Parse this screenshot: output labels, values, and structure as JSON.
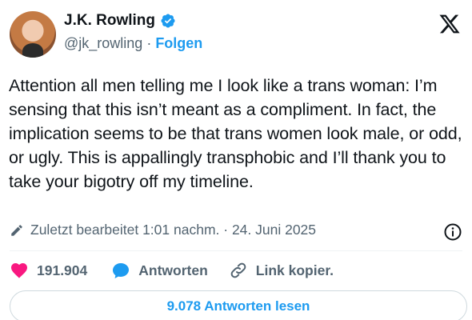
{
  "author": {
    "name": "J.K. Rowling",
    "handle": "@jk_rowling",
    "separator": "·",
    "follow_label": "Folgen"
  },
  "tweet": {
    "text": "Attention all men telling me I look like a trans woman: I’m sensing that this isn’t meant as a compliment. In fact, the implication seems to be that trans women look male, or odd, or ugly. This is appallingly transphobic and I’ll thank you to take your bigotry off my timeline.",
    "edited_label": "Zuletzt bearbeitet 1:01 nachm. · 24. Juni 2025"
  },
  "actions": {
    "likes": "191.904",
    "reply_label": "Antworten",
    "copy_link_label": "Link kopier."
  },
  "read_replies_label": "9.078 Antworten lesen",
  "colors": {
    "accent": "#1d9bf0",
    "like": "#f91880",
    "text": "#0f1419",
    "muted": "#536471"
  },
  "icons": [
    "verified-badge-icon",
    "x-logo-icon",
    "pencil-icon",
    "info-icon",
    "heart-icon",
    "reply-bubble-icon",
    "link-icon"
  ]
}
